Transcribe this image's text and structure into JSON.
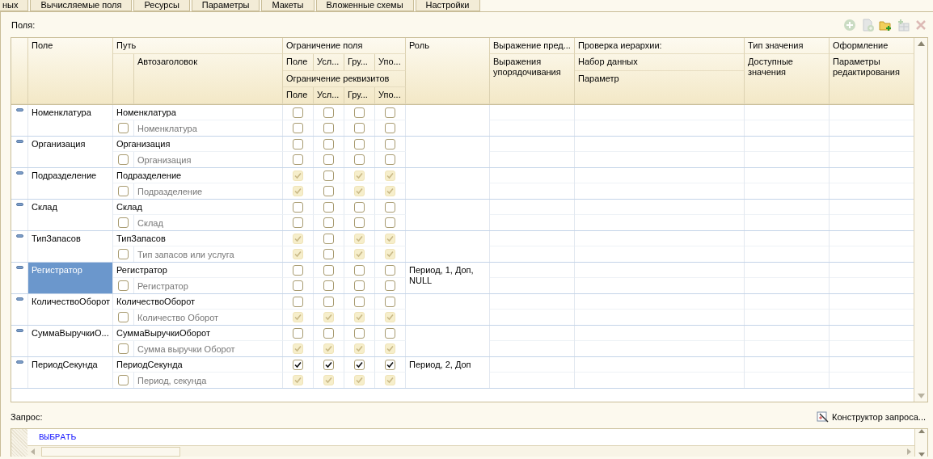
{
  "tabs": [
    {
      "label": "ных",
      "selected": false
    },
    {
      "label": "Вычисляемые поля",
      "selected": false
    },
    {
      "label": "Ресурсы",
      "selected": false
    },
    {
      "label": "Параметры",
      "selected": false
    },
    {
      "label": "Макеты",
      "selected": false
    },
    {
      "label": "Вложенные схемы",
      "selected": false
    },
    {
      "label": "Настройки",
      "selected": false
    }
  ],
  "fields_label": "Поля:",
  "toolbar": [
    {
      "kind": "add",
      "disabled": true
    },
    {
      "kind": "add-document",
      "disabled": true
    },
    {
      "kind": "add-folder",
      "disabled": false
    },
    {
      "kind": "add-table",
      "disabled": true
    },
    {
      "kind": "delete",
      "disabled": true
    }
  ],
  "header": {
    "field": "Поле",
    "path": "Путь",
    "autotitle": "Автозаголовок",
    "field_restriction": "Ограничение поля",
    "field_restriction_columns": [
      "Поле",
      "Усл...",
      "Гру...",
      "Упо..."
    ],
    "attribute_restriction": "Ограничение реквизитов",
    "attribute_restriction_columns": [
      "Поле",
      "Усл...",
      "Гру...",
      "Упо..."
    ],
    "role": "Роль",
    "presentation_expression": "Выражение пред...",
    "order_expressions": "Выражения упорядочивания",
    "hierarchy_check": "Проверка иерархии:",
    "hierarchy_dataset": "Набор данных",
    "hierarchy_parameter": "Параметр",
    "value_type": "Тип значения",
    "available_values": "Доступные значения",
    "appearance": "Оформление",
    "edit_parameters": "Параметры редактирования"
  },
  "rows": [
    {
      "field": "Номенклатура",
      "path": "Номенклатура",
      "autotitle_checked": false,
      "title": "Номенклатура",
      "selected": false,
      "field_restriction": [
        {
          "checked": false,
          "disabled": false
        },
        {
          "checked": false,
          "disabled": false
        },
        {
          "checked": false,
          "disabled": false
        },
        {
          "checked": false,
          "disabled": false
        }
      ],
      "attribute_restriction": [
        {
          "checked": false,
          "disabled": false
        },
        {
          "checked": false,
          "disabled": false
        },
        {
          "checked": false,
          "disabled": false
        },
        {
          "checked": false,
          "disabled": false
        }
      ]
    },
    {
      "field": "Организация",
      "path": "Организация",
      "autotitle_checked": false,
      "title": "Организация",
      "selected": false,
      "field_restriction": [
        {
          "checked": false,
          "disabled": false
        },
        {
          "checked": false,
          "disabled": false
        },
        {
          "checked": false,
          "disabled": false
        },
        {
          "checked": false,
          "disabled": false
        }
      ],
      "attribute_restriction": [
        {
          "checked": false,
          "disabled": false
        },
        {
          "checked": false,
          "disabled": false
        },
        {
          "checked": false,
          "disabled": false
        },
        {
          "checked": false,
          "disabled": false
        }
      ]
    },
    {
      "field": "Подразделение",
      "path": "Подразделение",
      "autotitle_checked": false,
      "title": "Подразделение",
      "selected": false,
      "field_restriction": [
        {
          "checked": true,
          "disabled": true
        },
        {
          "checked": false,
          "disabled": false
        },
        {
          "checked": true,
          "disabled": true
        },
        {
          "checked": true,
          "disabled": true
        }
      ],
      "attribute_restriction": [
        {
          "checked": true,
          "disabled": true
        },
        {
          "checked": false,
          "disabled": false
        },
        {
          "checked": true,
          "disabled": true
        },
        {
          "checked": true,
          "disabled": true
        }
      ]
    },
    {
      "field": "Склад",
      "path": "Склад",
      "autotitle_checked": false,
      "title": "Склад",
      "selected": false,
      "field_restriction": [
        {
          "checked": false,
          "disabled": false
        },
        {
          "checked": false,
          "disabled": false
        },
        {
          "checked": false,
          "disabled": false
        },
        {
          "checked": false,
          "disabled": false
        }
      ],
      "attribute_restriction": [
        {
          "checked": false,
          "disabled": false
        },
        {
          "checked": false,
          "disabled": false
        },
        {
          "checked": false,
          "disabled": false
        },
        {
          "checked": false,
          "disabled": false
        }
      ]
    },
    {
      "field": "ТипЗапасов",
      "path": "ТипЗапасов",
      "autotitle_checked": false,
      "title": "Тип запасов или услуга",
      "selected": false,
      "field_restriction": [
        {
          "checked": true,
          "disabled": true
        },
        {
          "checked": false,
          "disabled": false
        },
        {
          "checked": true,
          "disabled": true
        },
        {
          "checked": true,
          "disabled": true
        }
      ],
      "attribute_restriction": [
        {
          "checked": true,
          "disabled": true
        },
        {
          "checked": false,
          "disabled": false
        },
        {
          "checked": true,
          "disabled": true
        },
        {
          "checked": true,
          "disabled": true
        }
      ]
    },
    {
      "field": "Регистратор",
      "path": "Регистратор",
      "autotitle_checked": false,
      "title": "Регистратор",
      "selected": true,
      "role": "Период, 1, Доп, NULL",
      "field_restriction": [
        {
          "checked": false,
          "disabled": false
        },
        {
          "checked": false,
          "disabled": false
        },
        {
          "checked": false,
          "disabled": false
        },
        {
          "checked": false,
          "disabled": false
        }
      ],
      "attribute_restriction": [
        {
          "checked": false,
          "disabled": false
        },
        {
          "checked": false,
          "disabled": false
        },
        {
          "checked": false,
          "disabled": false
        },
        {
          "checked": false,
          "disabled": false
        }
      ]
    },
    {
      "field": "КоличествоОборот",
      "path": "КоличествоОборот",
      "autotitle_checked": false,
      "title": "Количество Оборот",
      "selected": false,
      "field_restriction": [
        {
          "checked": false,
          "disabled": false
        },
        {
          "checked": false,
          "disabled": false
        },
        {
          "checked": false,
          "disabled": false
        },
        {
          "checked": false,
          "disabled": false
        }
      ],
      "attribute_restriction": [
        {
          "checked": true,
          "disabled": true
        },
        {
          "checked": true,
          "disabled": true
        },
        {
          "checked": true,
          "disabled": true
        },
        {
          "checked": true,
          "disabled": true
        }
      ]
    },
    {
      "field": "СуммаВыручкиО...",
      "path": "СуммаВыручкиОборот",
      "autotitle_checked": false,
      "title": "Сумма выручки Оборот",
      "selected": false,
      "field_restriction": [
        {
          "checked": false,
          "disabled": false
        },
        {
          "checked": false,
          "disabled": false
        },
        {
          "checked": false,
          "disabled": false
        },
        {
          "checked": false,
          "disabled": false
        }
      ],
      "attribute_restriction": [
        {
          "checked": true,
          "disabled": true
        },
        {
          "checked": true,
          "disabled": true
        },
        {
          "checked": true,
          "disabled": true
        },
        {
          "checked": true,
          "disabled": true
        }
      ]
    },
    {
      "field": "ПериодСекунда",
      "path": "ПериодСекунда",
      "autotitle_checked": false,
      "title": "Период, секунда",
      "selected": false,
      "role": "Период, 2, Доп",
      "field_restriction": [
        {
          "checked": true,
          "disabled": false
        },
        {
          "checked": true,
          "disabled": false
        },
        {
          "checked": true,
          "disabled": false
        },
        {
          "checked": true,
          "disabled": false
        }
      ],
      "attribute_restriction": [
        {
          "checked": true,
          "disabled": true
        },
        {
          "checked": true,
          "disabled": true
        },
        {
          "checked": true,
          "disabled": true
        },
        {
          "checked": true,
          "disabled": true
        }
      ]
    }
  ],
  "query_label": "Запрос:",
  "query_builder_button": "Конструктор запроса...",
  "query_text": "ВЫБРАТЬ"
}
